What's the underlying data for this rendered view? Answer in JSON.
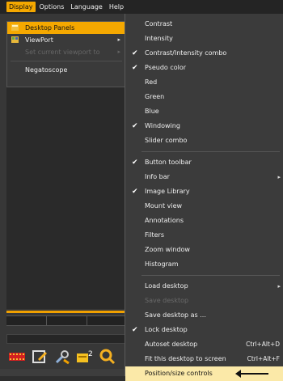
{
  "menubar": {
    "items": [
      {
        "label": "Display",
        "active": true
      },
      {
        "label": "Options",
        "active": false
      },
      {
        "label": "Language",
        "active": false
      },
      {
        "label": "Help",
        "active": false
      }
    ]
  },
  "display_menu": {
    "items": [
      {
        "label": "Desktop Panels",
        "icon": "desktop-panels-icon",
        "highlighted": true
      },
      {
        "label": "ViewPort",
        "icon": "viewport-icon",
        "submenu": true
      },
      {
        "label": "Set current viewport to",
        "disabled": true,
        "submenu": true
      },
      {
        "label": "Negatoscope"
      }
    ]
  },
  "panels_menu": {
    "group1": [
      {
        "label": "Contrast",
        "checked": false
      },
      {
        "label": "Intensity",
        "checked": false
      },
      {
        "label": "Contrast/Intensity combo",
        "checked": true
      },
      {
        "label": "Pseudo color",
        "checked": true
      },
      {
        "label": "Red",
        "checked": false
      },
      {
        "label": "Green",
        "checked": false
      },
      {
        "label": "Blue",
        "checked": false
      },
      {
        "label": "Windowing",
        "checked": true
      },
      {
        "label": "Slider combo",
        "checked": false
      }
    ],
    "group2": [
      {
        "label": "Button toolbar",
        "checked": true
      },
      {
        "label": "Info bar",
        "checked": false,
        "submenu": true
      },
      {
        "label": "Image Library",
        "checked": true
      },
      {
        "label": "Mount view",
        "checked": false
      },
      {
        "label": "Annotations",
        "checked": false
      },
      {
        "label": "Filters",
        "checked": false
      },
      {
        "label": "Zoom window",
        "checked": false
      },
      {
        "label": "Histogram",
        "checked": false
      }
    ],
    "group3": [
      {
        "label": "Load desktop",
        "submenu": true
      },
      {
        "label": "Save desktop",
        "disabled": true
      },
      {
        "label": "Save desktop as ..."
      },
      {
        "label": "Lock desktop",
        "checked": true
      },
      {
        "label": "Autoset desktop",
        "shortcut": "Ctrl+Alt+D"
      },
      {
        "label": "Fit this desktop to screen",
        "shortcut": "Ctrl+Alt+F"
      },
      {
        "label": "Position/size controls",
        "highlighted": true,
        "annotated": true
      }
    ],
    "check_glyph": "✔",
    "arrow_glyph": "▸"
  },
  "toolbar": {
    "icons": [
      "film-strip-icon",
      "edit-icon",
      "tools-icon",
      "window-level-icon",
      "zoom-icon"
    ]
  },
  "colors": {
    "accent": "#f5a800",
    "menu_bg": "#3b3b3b",
    "highlight_bg": "#fbe9a8"
  }
}
